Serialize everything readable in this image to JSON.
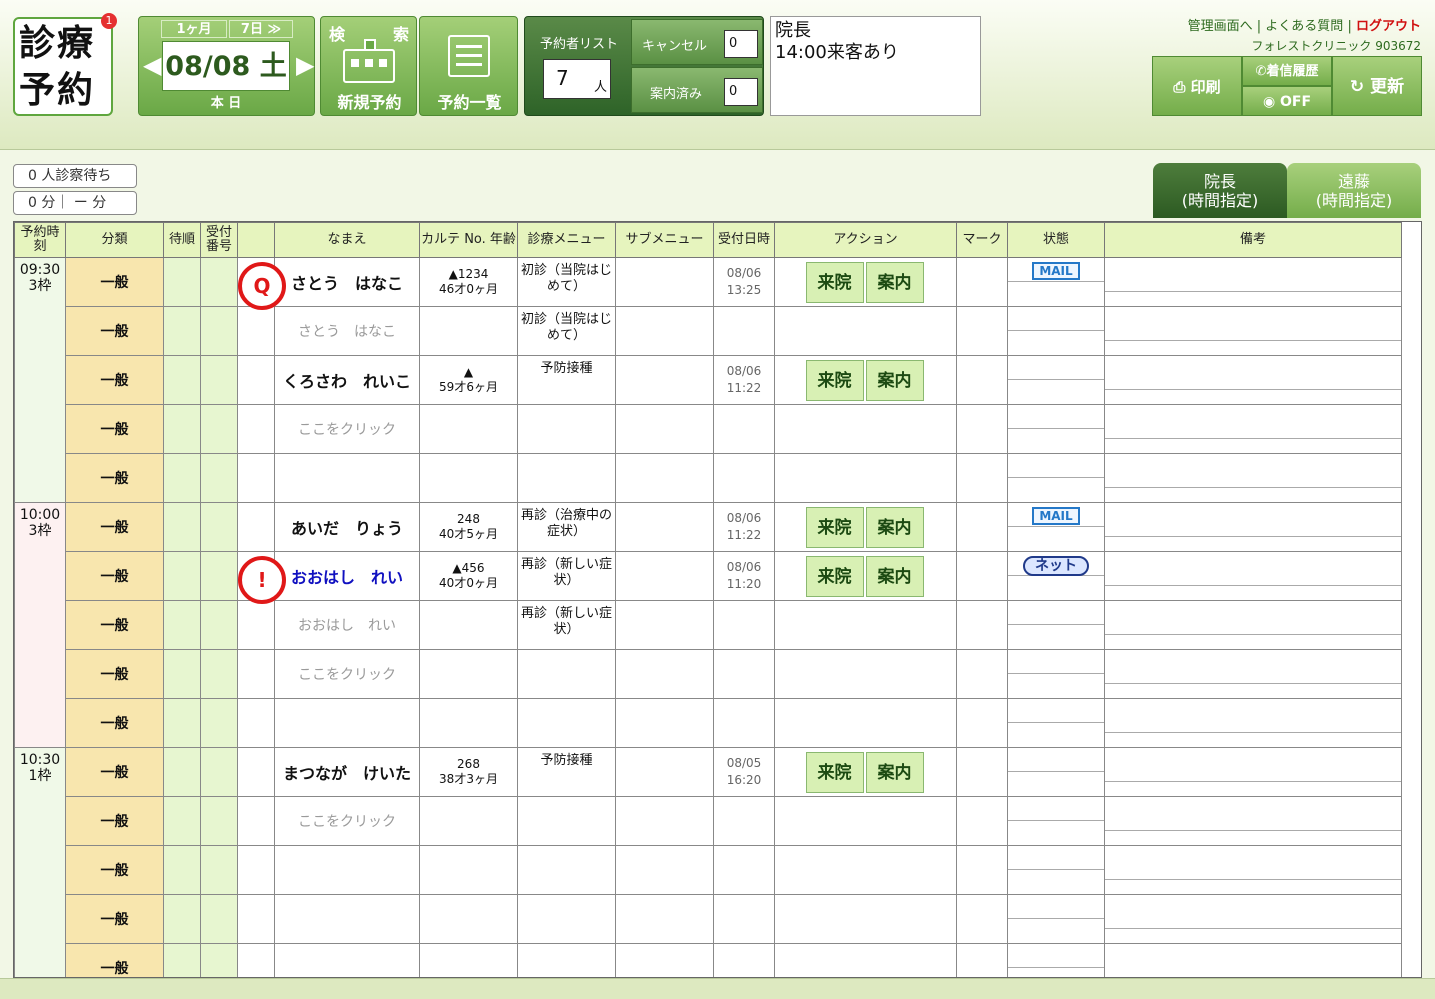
{
  "logo": {
    "line1": "診療",
    "line2": "予約",
    "badge": "1"
  },
  "date_nav": {
    "month_btn": "1ヶ月",
    "week_btn": "7日 ≫",
    "date": "08/08 土",
    "today_btn": "本 日",
    "prev": "◀",
    "next": "▶"
  },
  "search_btn": {
    "top_left": "検",
    "top_right": "索",
    "label": "新規予約"
  },
  "list_btn": {
    "label": "予約一覧"
  },
  "reserve_list": {
    "label": "予約者リスト",
    "count": "7",
    "unit": "人"
  },
  "cancel": {
    "label": "キャンセル",
    "value": "0"
  },
  "guided": {
    "label": "案内済み",
    "value": "0"
  },
  "memo": "院長\n14:00来客あり",
  "top_links": {
    "admin": "管理画面へ",
    "sep1": "|",
    "faq": "よくある質問",
    "sep2": "|",
    "logout": "ログアウト"
  },
  "clinic": "フォレストクリニック 903672",
  "buttons": {
    "print": "印刷",
    "call_history": "着信履歴",
    "call_status": "OFF",
    "refresh": "更新"
  },
  "wait": {
    "line1": "0 人診察待ち",
    "line2": "0 分｜ ー 分"
  },
  "doctor_tabs": [
    {
      "name": "院長",
      "sub": "(時間指定)"
    },
    {
      "name": "遠藤",
      "sub": "(時間指定)"
    }
  ],
  "columns": {
    "time": "予約時刻",
    "category": "分類",
    "order": "待順",
    "reception_no": "受付番号",
    "mark_icon": "",
    "name": "なまえ",
    "chart": "カルテ No. 年齢",
    "menu": "診療メニュー",
    "submenu": "サブメニュー",
    "received": "受付日時",
    "action": "アクション",
    "mark": "マーク",
    "status": "状態",
    "remarks": "備考"
  },
  "action_labels": {
    "arrive": "来院",
    "guide": "案内"
  },
  "slots": [
    {
      "time": "09:30",
      "frames": "3枠",
      "rows": [
        {
          "cat": "一般",
          "mark": "Q",
          "name": "さとう　はなこ",
          "chart": "▲1234",
          "age": "46才0ヶ月",
          "menu": "初診（当院はじめて）",
          "received_date": "08/06",
          "received_time": "13:25",
          "actions": true,
          "status": "MAIL"
        },
        {
          "cat": "一般",
          "name": "さとう　はなこ",
          "ghost": true,
          "menu": "初診（当院はじめて）"
        },
        {
          "cat": "一般",
          "name": "くろさわ　れいこ",
          "chart": "▲",
          "age": "59才6ヶ月",
          "menu": "予防接種",
          "received_date": "08/06",
          "received_time": "11:22",
          "actions": true
        },
        {
          "cat": "一般",
          "name": "ここをクリック",
          "ghost": true
        },
        {
          "cat": "一般"
        }
      ]
    },
    {
      "time": "10:00",
      "frames": "3枠",
      "rows": [
        {
          "cat": "一般",
          "name": "あいだ　りょう",
          "chart": "248",
          "age": "40才5ヶ月",
          "menu": "再診（治療中の症状）",
          "received_date": "08/06",
          "received_time": "11:22",
          "actions": true,
          "status": "MAIL"
        },
        {
          "cat": "一般",
          "mark": "!",
          "name": "おおはし　れい",
          "blue": true,
          "chart": "▲456",
          "age": "40才0ヶ月",
          "menu": "再診（新しい症状）",
          "received_date": "08/06",
          "received_time": "11:20",
          "actions": true,
          "status": "ネット"
        },
        {
          "cat": "一般",
          "name": "おおはし　れい",
          "ghost": true,
          "menu": "再診（新しい症状）"
        },
        {
          "cat": "一般",
          "name": "ここをクリック",
          "ghost": true
        },
        {
          "cat": "一般"
        }
      ]
    },
    {
      "time": "10:30",
      "frames": "1枠",
      "rows": [
        {
          "cat": "一般",
          "name": "まつなが　けいた",
          "chart": "268",
          "age": "38才3ヶ月",
          "menu": "予防接種",
          "received_date": "08/05",
          "received_time": "16:20",
          "actions": true
        },
        {
          "cat": "一般",
          "name": "ここをクリック",
          "ghost": true
        },
        {
          "cat": "一般"
        },
        {
          "cat": "一般"
        },
        {
          "cat": "一般"
        }
      ]
    }
  ]
}
